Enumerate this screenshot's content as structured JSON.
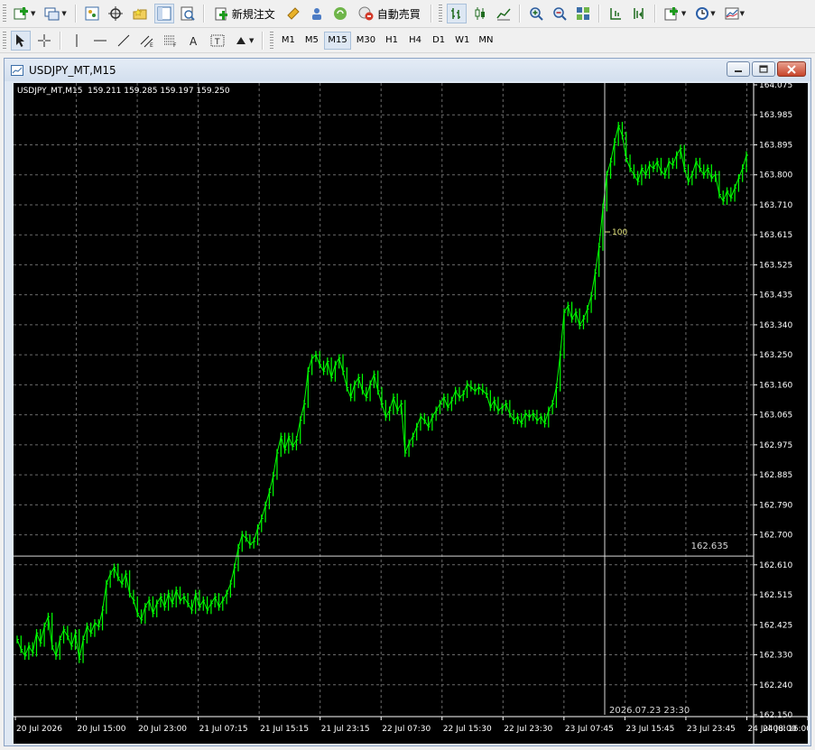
{
  "toolbar": {
    "new_order_label": "新規注文",
    "auto_trade_label": "自動売買",
    "timeframes": [
      "M1",
      "M5",
      "M15",
      "M30",
      "H1",
      "H4",
      "D1",
      "W1",
      "MN"
    ],
    "active_timeframe": "M15"
  },
  "window": {
    "title": "USDJPY_MT,M15",
    "controls": [
      "minimize",
      "restore",
      "close"
    ]
  },
  "chart": {
    "info_line": "USDJPY_MT,M15  159.211 159.285 159.197 159.250",
    "crosshair_price_label": "162.635",
    "crosshair_time_label": "2026.07.23 23:30",
    "crosshair_bar_count": "100",
    "colors": {
      "background": "#000000",
      "bars": "#00ff00",
      "grid": "#6b6b6b",
      "axis_text": "#ffffff"
    }
  },
  "chart_data": {
    "type": "line",
    "symbol": "USDJPY_MT",
    "timeframe": "M15",
    "ylim": [
      162.15,
      164.075
    ],
    "y_ticks": [
      "164.075",
      "163.985",
      "163.895",
      "163.800",
      "163.710",
      "163.615",
      "163.525",
      "163.435",
      "163.340",
      "163.250",
      "163.160",
      "163.065",
      "162.975",
      "162.885",
      "162.790",
      "162.700",
      "162.610",
      "162.515",
      "162.425",
      "162.330",
      "162.240",
      "162.150"
    ],
    "x_ticks": [
      "20 Jul 2026",
      "20 Jul 15:00",
      "20 Jul 23:00",
      "21 Jul 07:15",
      "21 Jul 15:15",
      "21 Jul 23:15",
      "22 Jul 07:30",
      "22 Jul 15:30",
      "22 Jul 23:30",
      "23 Jul 07:45",
      "23 Jul 15:45",
      "23 Jul 23:45",
      "24 Jul 08:00",
      "24 Jul 16:00"
    ],
    "grid": true,
    "series": [
      {
        "values": [
          162.38,
          162.35,
          162.33,
          162.36,
          162.34,
          162.4,
          162.37,
          162.42,
          162.45,
          162.36,
          162.33,
          162.38,
          162.41,
          162.39,
          162.36,
          162.4,
          162.32,
          162.38,
          162.42,
          162.4,
          162.43,
          162.42,
          162.47,
          162.55,
          162.58,
          162.6,
          162.57,
          162.55,
          162.58,
          162.52,
          162.5,
          162.46,
          162.44,
          162.48,
          162.5,
          162.46,
          162.49,
          162.51,
          162.48,
          162.52,
          162.49,
          162.53,
          162.5,
          162.51,
          162.49,
          162.47,
          162.52,
          162.48,
          162.5,
          162.47,
          162.49,
          162.51,
          162.48,
          162.5,
          162.52,
          162.55,
          162.6,
          162.66,
          162.7,
          162.69,
          162.67,
          162.68,
          162.72,
          162.75,
          162.79,
          162.83,
          162.88,
          162.95,
          163.0,
          162.96,
          163.0,
          162.97,
          162.99,
          163.05,
          163.1,
          163.2,
          163.24,
          163.25,
          163.22,
          163.2,
          163.23,
          163.18,
          163.22,
          163.24,
          163.2,
          163.15,
          163.12,
          163.16,
          163.18,
          163.14,
          163.12,
          163.16,
          163.19,
          163.14,
          163.1,
          163.06,
          163.08,
          163.12,
          163.08,
          163.1,
          162.95,
          162.98,
          163.0,
          163.03,
          163.06,
          163.05,
          163.03,
          163.06,
          163.08,
          163.1,
          163.12,
          163.09,
          163.11,
          163.14,
          163.12,
          163.13,
          163.16,
          163.15,
          163.14,
          163.15,
          163.14,
          163.13,
          163.09,
          163.11,
          163.08,
          163.09,
          163.1,
          163.07,
          163.05,
          163.06,
          163.04,
          163.07,
          163.06,
          163.07,
          163.05,
          163.06,
          163.04,
          163.08,
          163.1,
          163.15,
          163.25,
          163.38,
          163.4,
          163.36,
          163.38,
          163.34,
          163.36,
          163.39,
          163.43,
          163.5,
          163.58,
          163.7,
          163.8,
          163.84,
          163.9,
          163.95,
          163.92,
          163.85,
          163.82,
          163.8,
          163.78,
          163.82,
          163.8,
          163.83,
          163.82,
          163.84,
          163.81,
          163.8,
          163.84,
          163.83,
          163.86,
          163.88,
          163.82,
          163.78,
          163.8,
          163.84,
          163.82,
          163.8,
          163.82,
          163.79,
          163.8,
          163.74,
          163.72,
          163.75,
          163.73,
          163.76,
          163.79,
          163.82,
          163.86
        ]
      }
    ]
  }
}
